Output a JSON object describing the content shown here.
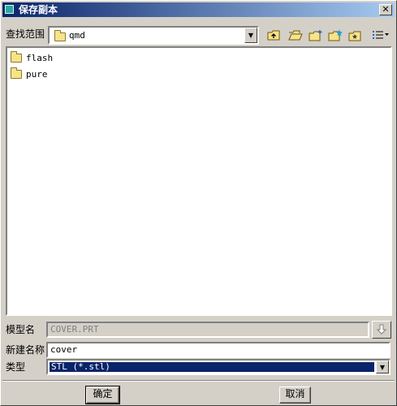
{
  "window": {
    "title": "保存副本",
    "close_glyph": "✕"
  },
  "lookin": {
    "label": "查找范围",
    "current_folder": "qmd"
  },
  "toolbar": {
    "icons": [
      "up-one-level-icon",
      "open-folder-icon",
      "new-folder-icon",
      "new-folder-star-icon",
      "favorites-folder-icon",
      "list-view-icon"
    ]
  },
  "files": [
    {
      "name": "flash",
      "type": "folder"
    },
    {
      "name": "pure",
      "type": "folder"
    }
  ],
  "form": {
    "model_label": "模型名",
    "model_value": "COVER.PRT",
    "newname_label": "新建名称",
    "newname_value": "cover",
    "type_label": "类型",
    "type_value": "STL (*.stl)"
  },
  "buttons": {
    "ok": "确定",
    "cancel": "取消"
  },
  "colors": {
    "titlebar_start": "#0a246a",
    "titlebar_end": "#a6caf0",
    "face": "#d4d0c8",
    "selection": "#0a246a"
  }
}
